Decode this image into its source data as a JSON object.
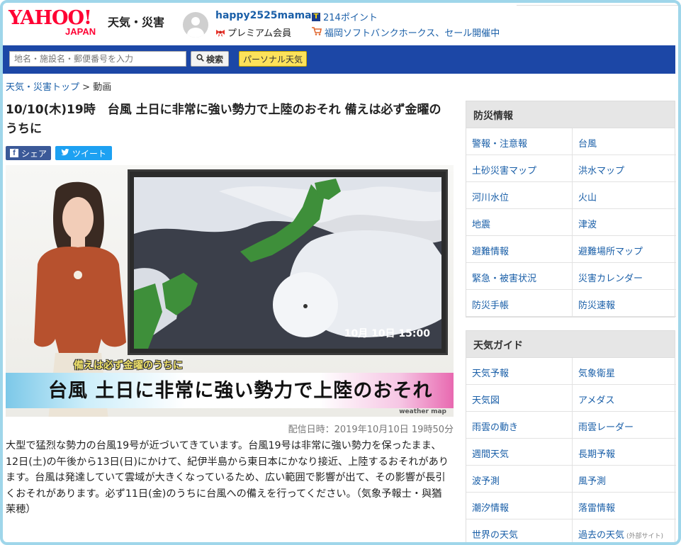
{
  "header": {
    "logo_main": "YAHOO!",
    "logo_sub": "JAPAN",
    "service_name": "天気・災害",
    "user": {
      "name": "happy2525mama",
      "membership": "プレミアム会員",
      "points": "214ポイント",
      "promo": "福岡ソフトバンクホークス、セール開催中"
    }
  },
  "search": {
    "placeholder": "地名・施設名・郵便番号を入力",
    "button_label": "検索",
    "personal_label": "パーソナル天気"
  },
  "breadcrumb": {
    "home": "天気・災害トップ",
    "separator": ">",
    "current": "動画"
  },
  "article": {
    "title": "10/10(木)19時　台風 土日に非常に強い勢力で上陸のおそれ 備えは必ず金曜のうちに",
    "share_label": "シェア",
    "tweet_label": "ツイート",
    "video": {
      "screen_time": "10月 10日 15:00",
      "caption_top": "備えは必ず金曜のうちに",
      "caption_main": "台風 土日に非常に強い勢力で上陸のおそれ",
      "watermark": "weather map"
    },
    "published": "配信日時：2019年10月10日 19時50分",
    "body": "大型で猛烈な勢力の台風19号が近づいてきています。台風19号は非常に強い勢力を保ったまま、12日(土)の午後から13日(日)にかけて、紀伊半島から東日本にかなり接近、上陸するおそれがあります。台風は発達していて雲域が大きくなっているため、広い範囲で影響が出て、その影響が長引くおそれがあります。必ず11日(金)のうちに台風への備えを行ってください。（気象予報士・與猶茉穂）"
  },
  "sidebar": {
    "bousai": {
      "title": "防災情報",
      "items": [
        "警報・注意報",
        "台風",
        "土砂災害マップ",
        "洪水マップ",
        "河川水位",
        "火山",
        "地震",
        "津波",
        "避難情報",
        "避難場所マップ",
        "緊急・被害状況",
        "災害カレンダー",
        "防災手帳",
        "防災速報"
      ]
    },
    "guide": {
      "title": "天気ガイド",
      "items": [
        "天気予報",
        "気象衛星",
        "天気図",
        "アメダス",
        "雨雲の動き",
        "雨雲レーダー",
        "週間天気",
        "長期予報",
        "波予測",
        "風予測",
        "潮汐情報",
        "落雷情報",
        "世界の天気",
        "過去の天気"
      ],
      "external_note": "(外部サイト)"
    }
  },
  "colors": {
    "brand_red": "#ff0033",
    "nav_blue": "#1c47a6",
    "link_blue": "#1a5fa8",
    "personal_yellow": "#fde25a",
    "frame_blue": "#9fd6ea"
  }
}
